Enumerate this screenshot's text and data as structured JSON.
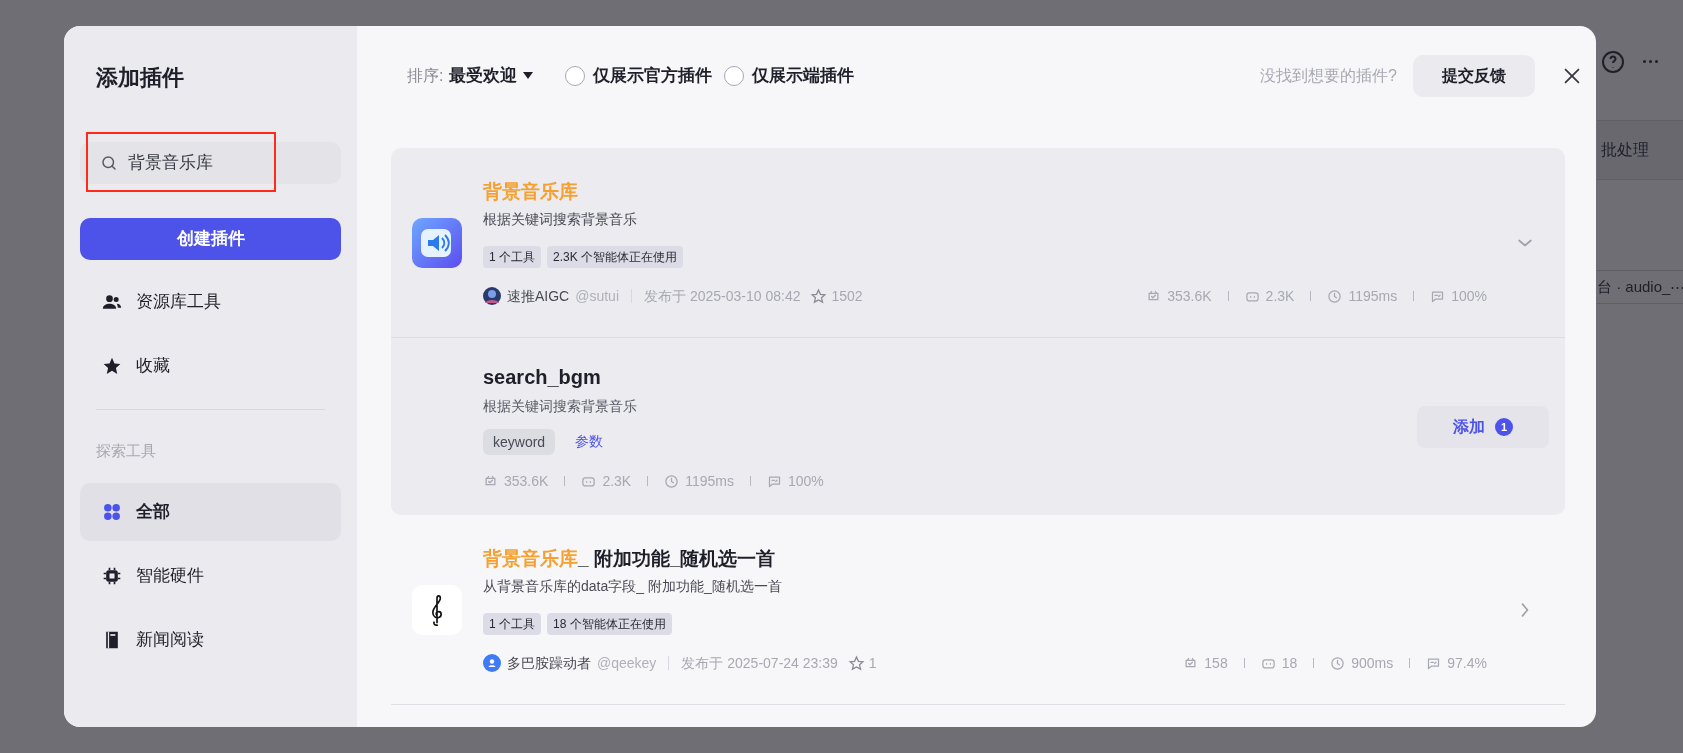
{
  "background": {
    "tab_label": "批处理",
    "node_label": "台 · audio_⋯"
  },
  "modal": {
    "title": "添加插件",
    "search": {
      "value": "背景音乐库",
      "highlighted": true
    },
    "create_button": "创建插件",
    "nav_top": [
      {
        "label": "资源库工具",
        "kind": "users",
        "selected": false
      },
      {
        "label": "收藏",
        "kind": "star",
        "selected": false
      }
    ],
    "section_label": "探索工具",
    "nav_explore": [
      {
        "label": "全部",
        "kind": "grid",
        "selected": true
      },
      {
        "label": "智能硬件",
        "kind": "chip",
        "selected": false
      },
      {
        "label": "新闻阅读",
        "kind": "book",
        "selected": false
      }
    ],
    "sort": {
      "label": "排序:",
      "value": "最受欢迎"
    },
    "filters": [
      {
        "label": "仅展示官方插件",
        "checked": false
      },
      {
        "label": "仅展示端插件",
        "checked": false
      }
    ],
    "feedback_prompt": "没找到想要的插件?",
    "feedback_button": "提交反馈",
    "plugins": [
      {
        "title_highlight": "背景音乐库",
        "description": "根据关键词搜索背景音乐",
        "kind": "speaker",
        "expanded": true,
        "tags": [
          "1 个工具",
          "2.3K 个智能体正在使用"
        ],
        "author": {
          "kind": "picture",
          "name": "速推AIGC",
          "handle": "@sutui"
        },
        "published": "发布于 2025-03-10 08:42",
        "favorites": "1502",
        "stats": [
          {
            "kind": "calls",
            "value": "353.6K"
          },
          {
            "kind": "bots",
            "value": "2.3K"
          },
          {
            "kind": "latency",
            "value": "1195ms"
          },
          {
            "kind": "success",
            "value": "100%"
          }
        ],
        "tools": [
          {
            "name": "search_bgm",
            "description": "根据关键词搜索背景音乐",
            "params": [
              "keyword"
            ],
            "params_link": "参数",
            "stats": [
              {
                "kind": "calls",
                "value": "353.6K"
              },
              {
                "kind": "bots",
                "value": "2.3K"
              },
              {
                "kind": "latency",
                "value": "1195ms"
              },
              {
                "kind": "success",
                "value": "100%"
              }
            ],
            "add_button": "添加",
            "add_count": "1"
          }
        ]
      },
      {
        "title_highlight": "背景音乐库",
        "title_rest": "_ 附加功能_随机选一首",
        "description": "从背景音乐库的data字段_ 附加功能_随机选一首",
        "kind": "clef",
        "expanded": false,
        "tags": [
          "1 个工具",
          "18 个智能体正在使用"
        ],
        "author": {
          "kind": "person",
          "name": "多巴胺躁动者",
          "handle": "@qeekey"
        },
        "published": "发布于 2025-07-24 23:39",
        "favorites": "1",
        "stats": [
          {
            "kind": "calls",
            "value": "158"
          },
          {
            "kind": "bots",
            "value": "18"
          },
          {
            "kind": "latency",
            "value": "900ms"
          },
          {
            "kind": "success",
            "value": "97.4%"
          }
        ]
      }
    ]
  }
}
